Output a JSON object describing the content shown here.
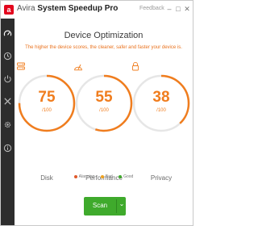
{
  "window": {
    "title_brand": "Avira",
    "title_product": "System Speedup Pro",
    "feedback": "Feedback",
    "buttons": {
      "minimize": "–",
      "maximize": "□",
      "close": "✕"
    }
  },
  "sidebar": {
    "items": [
      {
        "icon": "speedometer-icon"
      },
      {
        "icon": "clock-icon"
      },
      {
        "icon": "power-icon"
      },
      {
        "icon": "tools-icon"
      },
      {
        "icon": "gear-icon"
      },
      {
        "icon": "info-icon"
      }
    ]
  },
  "main": {
    "title": "Device Optimization",
    "subtitle": "The higher the device scores, the cleaner, safer and faster your device is."
  },
  "gauges": [
    {
      "label": "Disk",
      "score": "75",
      "max": "/100",
      "fraction": 0.75,
      "icon": "disk-icon"
    },
    {
      "label": "Performance",
      "score": "55",
      "max": "/100",
      "fraction": 0.55,
      "icon": "performance-icon"
    },
    {
      "label": "Privacy",
      "score": "38",
      "max": "/100",
      "fraction": 0.38,
      "icon": "lock-icon"
    }
  ],
  "legend": [
    {
      "label": "Alarming",
      "color": "#e05a2b"
    },
    {
      "label": "Bad",
      "color": "#f0a21e"
    },
    {
      "label": "Good",
      "color": "#3faa2c"
    }
  ],
  "scan": {
    "label": "Scan",
    "arrow": "⌄"
  },
  "colors": {
    "accent": "#f07d1e",
    "track": "#e6e6e6",
    "scan": "#3faa2c",
    "sidebar": "#2d2d2d"
  }
}
